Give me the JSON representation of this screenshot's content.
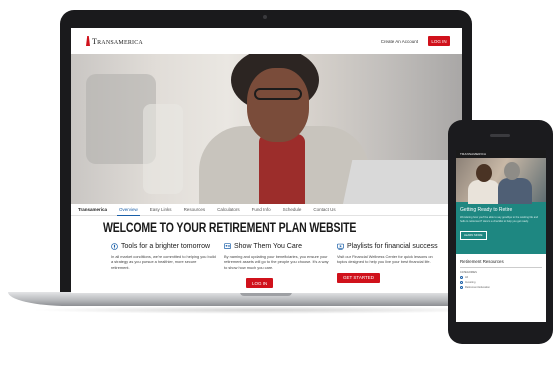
{
  "colors": {
    "brand_red": "#d0111b",
    "nav_active": "#1a5fa8",
    "phone_teal": "#1e8781"
  },
  "header": {
    "logo_text": "Transamerica",
    "create_account": "Create An Account",
    "login_label": "LOG IN"
  },
  "nav": {
    "items": [
      "Transamerica",
      "Overview",
      "Easy Links",
      "Resources",
      "Calculators",
      "Fund Info",
      "Schedule",
      "Contact Us"
    ]
  },
  "main": {
    "welcome_title": "WELCOME TO YOUR RETIREMENT PLAN WEBSITE",
    "features": [
      {
        "icon": "lightbulb-icon",
        "title": "Tools for a brighter tomorrow",
        "body": "In all market conditions, we're committed to helping you build a strategy as you pursue a healthier, more secure retirement."
      },
      {
        "icon": "users-icon",
        "title": "Show Them You Care",
        "body": "By naming and updating your beneficiaries, you ensure your retirement assets will go to the people you choose. It's a way to show how much you care.",
        "button": "LOG IN"
      },
      {
        "icon": "playlist-icon",
        "title": "Playlists for financial success",
        "body": "Visit our Financial Wellness Center for quick lessons on topics designed to help you live your best financial life.",
        "button": "GET STARTED"
      }
    ]
  },
  "phone": {
    "logo_text": "TRANSAMERICA",
    "hero_title": "Getting Ready to Retire",
    "hero_body": "Wondering how you'll be able to say goodbye to the working life and hello to retirement? Here's a checklist to help you get ready.",
    "learn_more": "LEARN MORE",
    "resources_title": "Retirement Resources",
    "category_label": "CATEGORIES",
    "resource_items": [
      "All",
      "Investing",
      "Retirement Education"
    ]
  }
}
